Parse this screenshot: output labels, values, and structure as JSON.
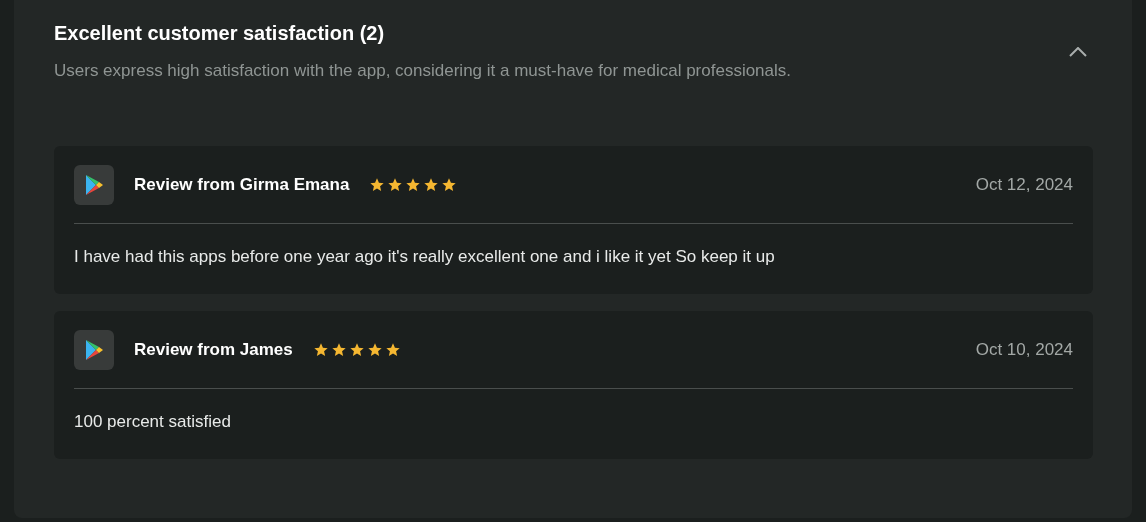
{
  "section": {
    "title": "Excellent customer satisfaction (2)",
    "description": "Users express high satisfaction with the app, considering it a must-have for medical professionals.",
    "expanded": true
  },
  "reviews": [
    {
      "title": "Review from Girma Emana",
      "stars": 5,
      "date": "Oct 12, 2024",
      "text": "I have had this apps before one year ago it's really excellent one and i like it yet So keep it up"
    },
    {
      "title": "Review from James",
      "stars": 5,
      "date": "Oct 10, 2024",
      "text": "100 percent satisfied"
    }
  ]
}
